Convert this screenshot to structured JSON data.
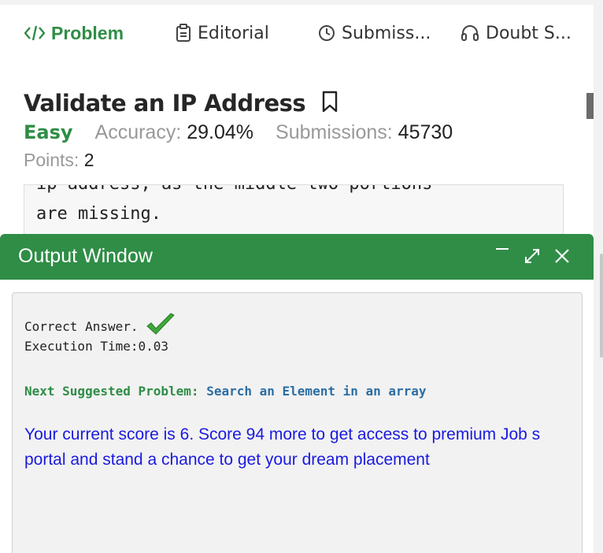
{
  "tabs": [
    {
      "label": "Problem",
      "icon": "code-icon"
    },
    {
      "label": "Editorial",
      "icon": "document-icon"
    },
    {
      "label": "Submiss...",
      "icon": "clock-icon"
    },
    {
      "label": "Doubt S...",
      "icon": "headset-icon"
    }
  ],
  "problem": {
    "title": "Validate an IP Address",
    "difficulty": "Easy",
    "accuracy_label": "Accuracy:",
    "accuracy_value": "29.04%",
    "submissions_label": "Submissions:",
    "submissions_value": "45730",
    "points_label": "Points:",
    "points_value": "2",
    "code_lines": [
      "ip address, as the middle two portions",
      "are missing."
    ]
  },
  "output": {
    "title": "Output Window",
    "result": "Correct Answer.",
    "exec_time": "Execution Time:0.03",
    "next_label": "Next Suggested Problem:",
    "next_link": "Search an Element in an array",
    "score_text": "Your current score is 6. Score 94 more to get access to premium Job s portal and stand a chance to get your dream placement"
  },
  "colors": {
    "accent": "#2f8d46",
    "link": "#2c6ea3",
    "score": "#1a1ae0"
  }
}
